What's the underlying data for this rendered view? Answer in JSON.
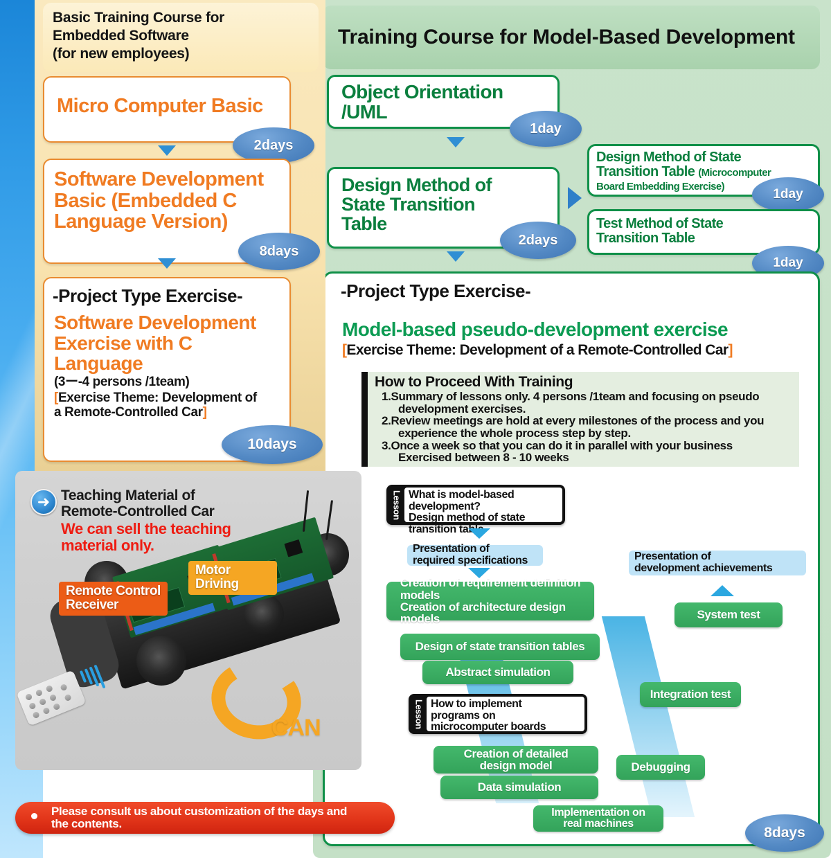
{
  "left": {
    "title": "Basic Training Course for Embedded Software (for new employees)",
    "courses": [
      {
        "name": "Micro Computer Basic",
        "days": "2days"
      },
      {
        "name": "Software Development Basic (Embedded C Language Version)",
        "days": "8days"
      }
    ],
    "project": {
      "label": "-Project Type Exercise-",
      "heading": "Software Development Exercise with C Language",
      "team": "(3ー-4 persons /1team)",
      "theme_open": "[",
      "theme": "Exercise Theme: Development of a Remote-Controlled Car",
      "theme_close": "]",
      "days": "10days"
    }
  },
  "teaching": {
    "icon": "arrow-right-circle-icon",
    "title": "Teaching Material of Remote-Controlled Car",
    "note": "We can sell the teaching material only.",
    "callouts": {
      "remote": "Remote Control Receiver",
      "motor": "Motor  Driving",
      "bus": "CAN"
    }
  },
  "notice": {
    "bullet": "•",
    "text": "Please consult us about customization of the days and the contents."
  },
  "right": {
    "title": "Training Course for Model-Based Development",
    "courses": [
      {
        "name": "Object Orientation /UML",
        "days": "1day"
      },
      {
        "name": "Design Method of State Transition Table",
        "days": "2days"
      }
    ],
    "branches": [
      {
        "name": "Design Method of State Transition Table ",
        "sub": "(Microcomputer Board Embedding Exercise)",
        "days": "1day"
      },
      {
        "name": "Test Method of State Transition Table",
        "sub": "",
        "days": "1day"
      }
    ],
    "project": {
      "label": "-Project Type Exercise-",
      "heading": "Model-based  pseudo-development  exercise",
      "theme_open": "[",
      "theme": "Exercise Theme: Development of a Remote-Controlled Car",
      "theme_close": "]",
      "days": "8days"
    },
    "howto": {
      "title": "How to Proceed With Training",
      "items": [
        {
          "n": "1.",
          "a": "Summary of lessons only. 4 persons /1team and focusing on  pseudo",
          "b": "development  exercises."
        },
        {
          "n": "2.",
          "a": "Review meetings are hold at every milestones of the process  and you",
          "b": "experience  the  whole process step by step."
        },
        {
          "n": "3.",
          "a": "Once a week so that you can do it in parallel  with your business",
          "b": "Exercised between 8 - 10 weeks"
        }
      ]
    },
    "flow": {
      "lesson_tab": "Lesson",
      "lesson1": "What is model-based development? Design method of state transition table",
      "lesson2": "How to implement programs on microcomputer  boards",
      "spec_in": "Presentation  of required  specifications",
      "spec_out": "Presentation  of development achievements",
      "steps_left": [
        "Creation of requirement  definition models Creation of architecture  design models",
        "Design of state transition  tables",
        "Abstract  simulation",
        "Creation of detailed design model",
        "Data simulation",
        "Implementation  on real machines"
      ],
      "steps_right": [
        "System test",
        "Integration  test",
        "Debugging"
      ]
    }
  },
  "colors": {
    "orange": "#f07b22",
    "green": "#0b7f3e",
    "flow_green": "#33a35a",
    "blue_oval": "#4a86c8",
    "red": "#e03318",
    "cream": "#f8e2ae",
    "panel_green": "#c4e0c6"
  }
}
